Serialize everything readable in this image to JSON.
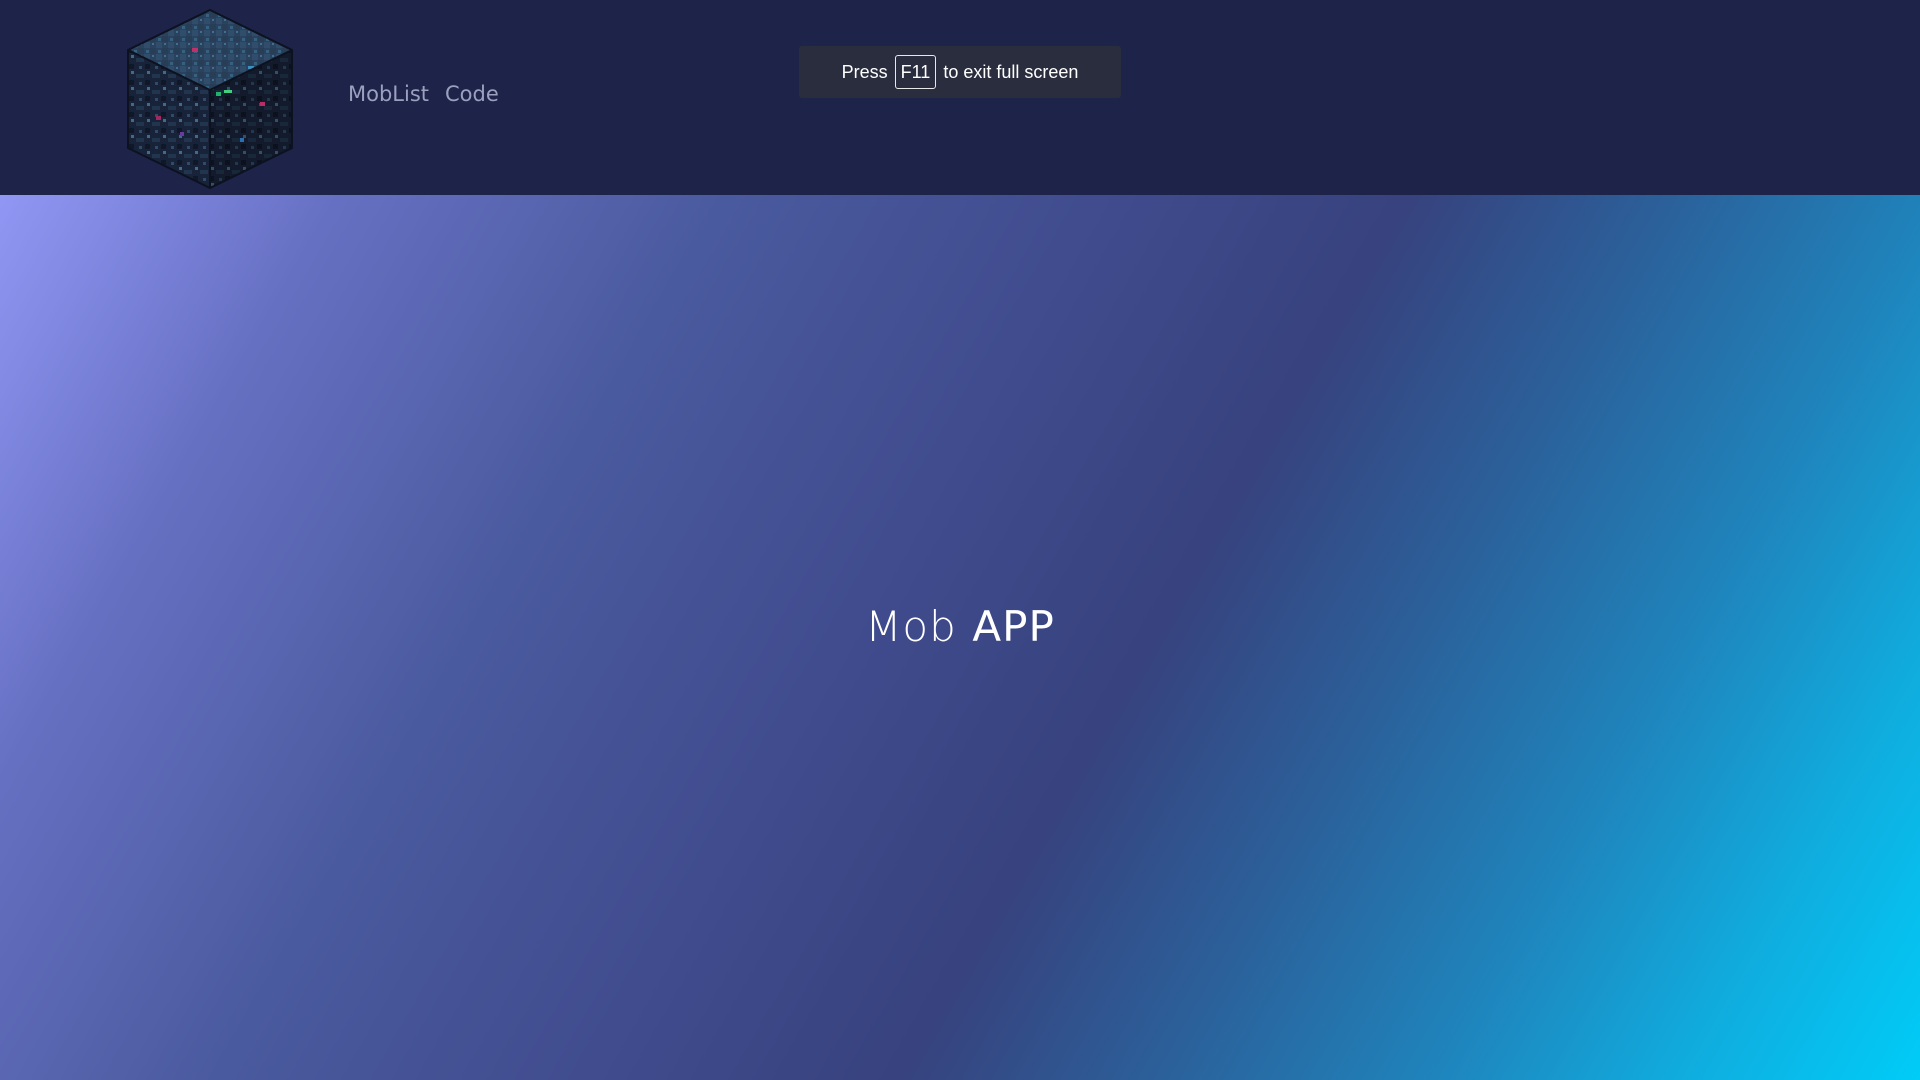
{
  "nav": {
    "logo_icon": "ore-block-cube-icon",
    "links": [
      {
        "label": "MobList"
      },
      {
        "label": "Code"
      }
    ],
    "background": "#1e2349",
    "link_color": "#9aa0bd"
  },
  "hero": {
    "title_prefix": "Mob",
    "title_main": "APP",
    "gradient_colors": [
      "#9097f4",
      "#404c8e",
      "#37427e",
      "#00ccf8"
    ]
  },
  "fullscreen_toast": {
    "prefix": "Press",
    "key": "F11",
    "suffix": "to exit full screen"
  }
}
